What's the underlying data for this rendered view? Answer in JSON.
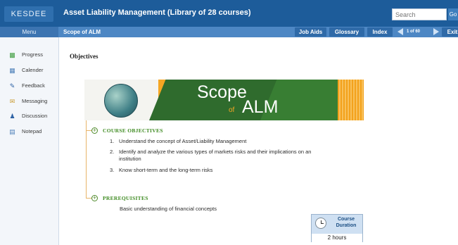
{
  "header": {
    "logo_text": "KESDEE",
    "app_title": "Asset Liability Management (Library of 28 courses)",
    "search_placeholder": "Search",
    "go_label": "Go"
  },
  "subbar": {
    "menu_label": "Menu",
    "page_title": "Scope of ALM",
    "buttons": {
      "job_aids": "Job Aids",
      "glossary": "Glossary",
      "index": "Index",
      "exit": "Exit"
    },
    "page_info": "1 of 60"
  },
  "sidebar": {
    "items": [
      {
        "label": "Progress",
        "icon": "chart-icon"
      },
      {
        "label": "Calender",
        "icon": "calendar-icon"
      },
      {
        "label": "Feedback",
        "icon": "pencil-icon"
      },
      {
        "label": "Messaging",
        "icon": "envelope-icon"
      },
      {
        "label": "Discussion",
        "icon": "people-icon"
      },
      {
        "label": "Notepad",
        "icon": "notepad-icon"
      }
    ]
  },
  "main": {
    "section_title": "Objectives",
    "banner": {
      "title_scope": "Scope",
      "title_of": "of",
      "title_alm": "ALM"
    },
    "course_objectives_heading": "COURSE OBJECTIVES",
    "objectives": [
      {
        "num": "1.",
        "text": "Understand the concept of Asset/Liability Management"
      },
      {
        "num": "2.",
        "text": "Identify and analyze the various types of markets risks and their implications on an institution"
      },
      {
        "num": "3.",
        "text": "Know short-term and the long-term risks"
      }
    ],
    "prerequisites_heading": "PREREQUISITES",
    "prerequisites_text": "Basic understanding of financial concepts",
    "duration": {
      "label": "Course Duration",
      "value": "2 hours"
    }
  },
  "colors": {
    "header_blue": "#1d5c9a",
    "subbar_blue": "#4d87c4",
    "banner_green": "#2f6b2d",
    "banner_orange": "#f5a623",
    "heading_green": "#3f8b22"
  }
}
